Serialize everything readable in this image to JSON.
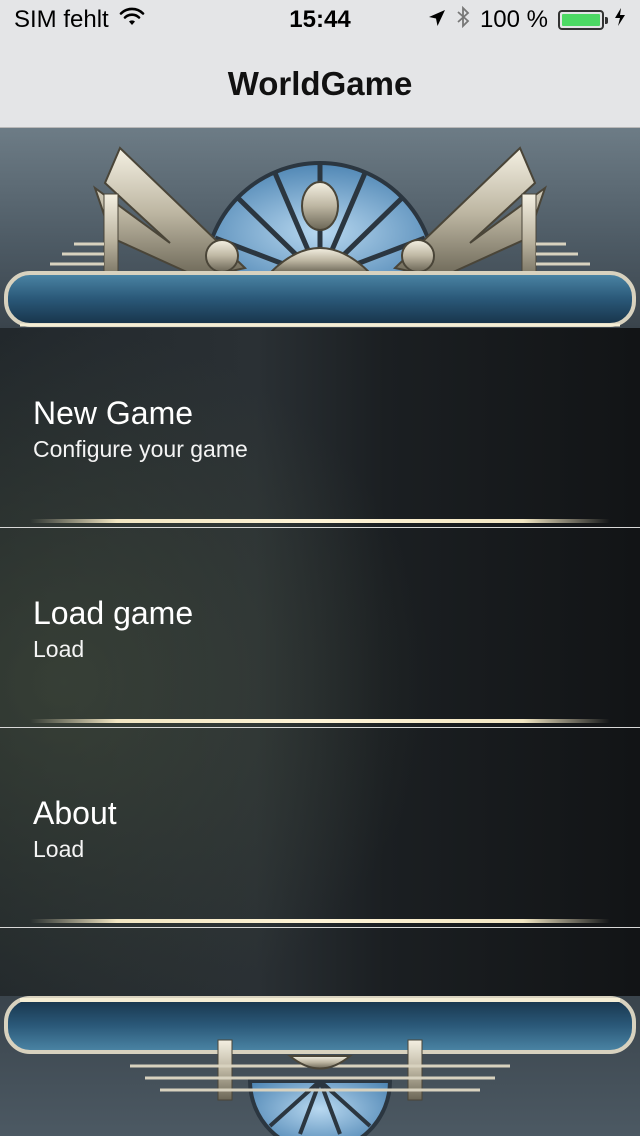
{
  "status_bar": {
    "carrier": "SIM fehlt",
    "time": "15:44",
    "battery_percent": "100 %",
    "icons": [
      "wifi-icon",
      "location-arrow-icon",
      "bluetooth-icon",
      "battery-icon",
      "charging-bolt-icon"
    ]
  },
  "nav": {
    "title": "WorldGame"
  },
  "menu": [
    {
      "title": "New Game",
      "subtitle": "Configure your game"
    },
    {
      "title": "Load game",
      "subtitle": "Load"
    },
    {
      "title": "About",
      "subtitle": "Load"
    }
  ],
  "colors": {
    "bar_background": "#e4e5e7",
    "battery_fill": "#4cd964",
    "panel_blue": "#2f5f80",
    "ornament_metal": "#cfc9b8",
    "menu_text": "#ffffff"
  }
}
